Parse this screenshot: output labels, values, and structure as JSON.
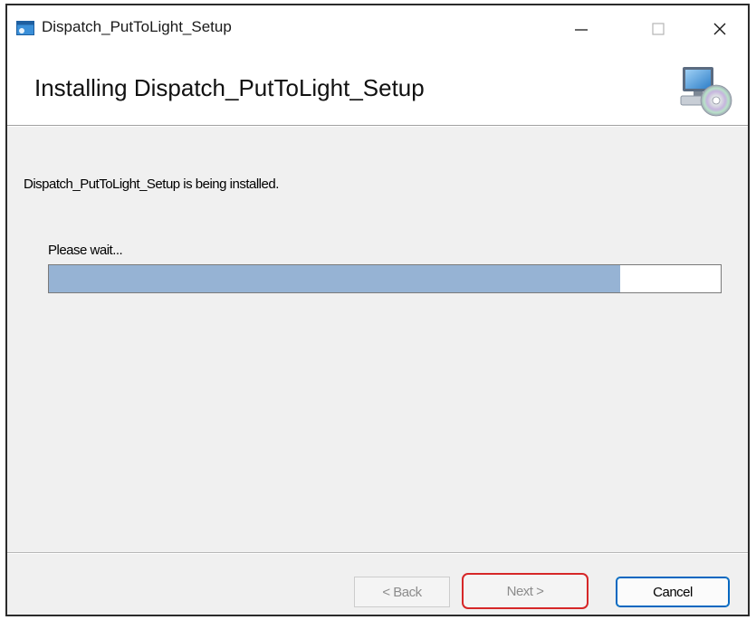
{
  "window": {
    "title": "Dispatch_PutToLight_Setup"
  },
  "controls": {
    "minimize_glyph": "—",
    "maximize_glyph": "☐",
    "close_glyph": "✕"
  },
  "header": {
    "title": "Installing Dispatch_PutToLight_Setup",
    "icon": "computer-cd-icon"
  },
  "body": {
    "status": "Dispatch_PutToLight_Setup is being installed.",
    "wait_label": "Please wait...",
    "progress": 0.85
  },
  "buttons": {
    "back": "< Back",
    "next": "Next >",
    "cancel": "Cancel"
  },
  "colors": {
    "progress_fill": "#96b3d4",
    "highlight": "#d62728",
    "accent": "#0067c0"
  }
}
